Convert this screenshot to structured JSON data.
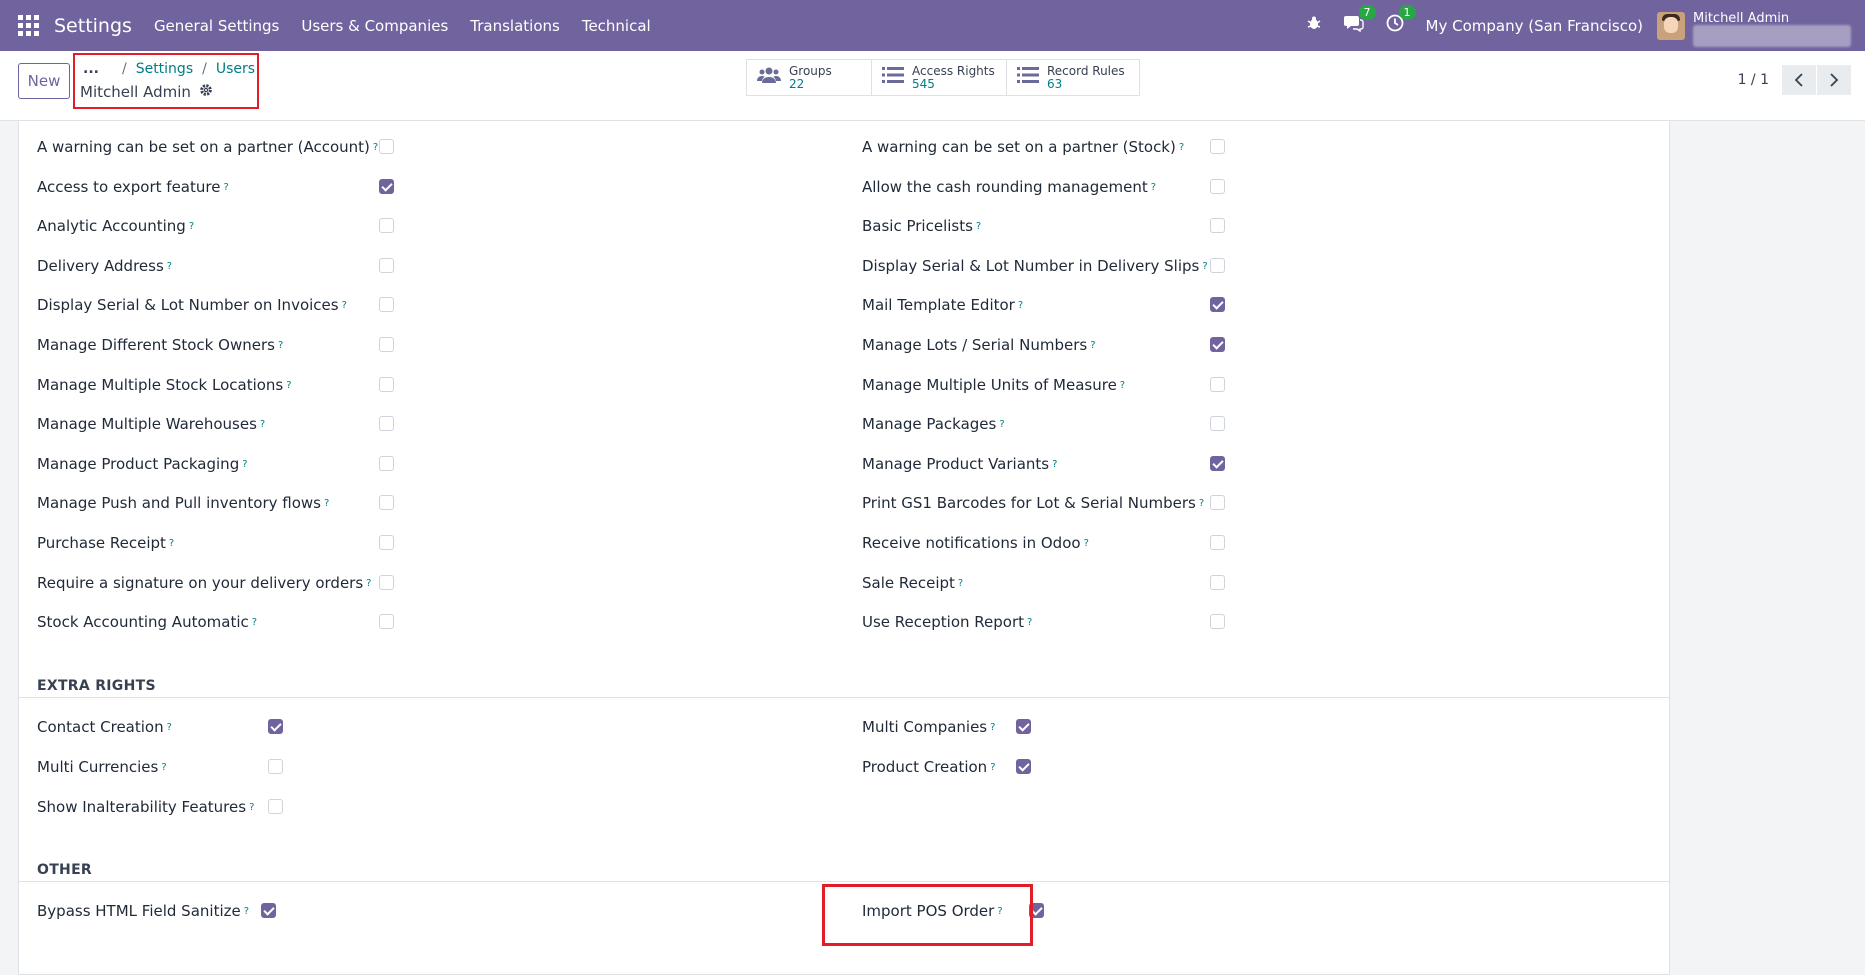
{
  "navbar": {
    "brand": "Settings",
    "menu": [
      "General Settings",
      "Users & Companies",
      "Translations",
      "Technical"
    ],
    "chat_badge": "7",
    "activity_badge": "1",
    "company": "My Company (San Francisco)",
    "user": "Mitchell Admin"
  },
  "control": {
    "new_label": "New",
    "breadcrumb_dots": "...",
    "breadcrumb": [
      "Settings",
      "Users"
    ],
    "record_title": "Mitchell Admin",
    "smart_buttons": [
      {
        "label": "Groups",
        "value": "22"
      },
      {
        "label": "Access Rights",
        "value": "545"
      },
      {
        "label": "Record Rules",
        "value": "63"
      }
    ],
    "pager": "1 / 1"
  },
  "technical": {
    "left": [
      {
        "label": "A warning can be set on a partner (Account)",
        "checked": false
      },
      {
        "label": "Access to export feature",
        "checked": true
      },
      {
        "label": "Analytic Accounting",
        "checked": false
      },
      {
        "label": "Delivery Address",
        "checked": false
      },
      {
        "label": "Display Serial & Lot Number on Invoices",
        "checked": false
      },
      {
        "label": "Manage Different Stock Owners",
        "checked": false
      },
      {
        "label": "Manage Multiple Stock Locations",
        "checked": false
      },
      {
        "label": "Manage Multiple Warehouses",
        "checked": false
      },
      {
        "label": "Manage Product Packaging",
        "checked": false
      },
      {
        "label": "Manage Push and Pull inventory flows",
        "checked": false
      },
      {
        "label": "Purchase Receipt",
        "checked": false
      },
      {
        "label": "Require a signature on your delivery orders",
        "checked": false
      },
      {
        "label": "Stock Accounting Automatic",
        "checked": false
      }
    ],
    "right": [
      {
        "label": "A warning can be set on a partner (Stock)",
        "checked": false
      },
      {
        "label": "Allow the cash rounding management",
        "checked": false
      },
      {
        "label": "Basic Pricelists",
        "checked": false
      },
      {
        "label": "Display Serial & Lot Number in Delivery Slips",
        "checked": false
      },
      {
        "label": "Mail Template Editor",
        "checked": true
      },
      {
        "label": "Manage Lots / Serial Numbers",
        "checked": true
      },
      {
        "label": "Manage Multiple Units of Measure",
        "checked": false
      },
      {
        "label": "Manage Packages",
        "checked": false
      },
      {
        "label": "Manage Product Variants",
        "checked": true
      },
      {
        "label": "Print GS1 Barcodes for Lot & Serial Numbers",
        "checked": false
      },
      {
        "label": "Receive notifications in Odoo",
        "checked": false
      },
      {
        "label": "Sale Receipt",
        "checked": false
      },
      {
        "label": "Use Reception Report",
        "checked": false
      }
    ]
  },
  "extra_rights": {
    "title": "EXTRA RIGHTS",
    "left": [
      {
        "label": "Contact Creation",
        "checked": true
      },
      {
        "label": "Multi Currencies",
        "checked": false
      },
      {
        "label": "Show Inalterability Features",
        "checked": false
      }
    ],
    "right": [
      {
        "label": "Multi Companies",
        "checked": true
      },
      {
        "label": "Product Creation",
        "checked": true
      }
    ]
  },
  "other": {
    "title": "OTHER",
    "left": [
      {
        "label": "Bypass HTML Field Sanitize",
        "checked": true
      }
    ],
    "right": [
      {
        "label": "Import POS Order",
        "checked": true
      }
    ]
  },
  "help_mark": "?"
}
